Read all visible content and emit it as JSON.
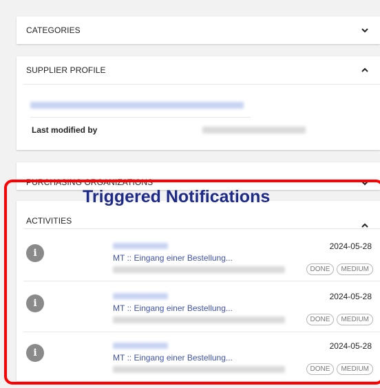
{
  "sections": {
    "categories": {
      "label": "CATEGORIES",
      "chevron": "chevron-down-icon"
    },
    "supplier_profile": {
      "label": "SUPPLIER PROFILE",
      "chevron": "chevron-up-icon",
      "last_modified_label": "Last modified by"
    },
    "purchasing_organizations": {
      "label": "PURCHASING ORGANIZATIONS",
      "chevron": "chevron-down-icon"
    },
    "activities": {
      "label": "ACTIVITIES",
      "chevron": "chevron-up-icon",
      "items": [
        {
          "date": "2024-05-28",
          "subject": "MT :: Eingang einer Bestellung...",
          "status": "DONE",
          "priority": "MEDIUM",
          "icon": "info-icon"
        },
        {
          "date": "2024-05-28",
          "subject": "MT :: Eingang einer Bestellung...",
          "status": "DONE",
          "priority": "MEDIUM",
          "icon": "info-icon"
        },
        {
          "date": "2024-05-28",
          "subject": "MT :: Eingang einer Bestellung...",
          "status": "DONE",
          "priority": "MEDIUM",
          "icon": "info-icon"
        }
      ]
    }
  },
  "annotation": {
    "text": "Triggered Notifications",
    "color": "#1d2a8a",
    "border_color": "#ff0000"
  }
}
